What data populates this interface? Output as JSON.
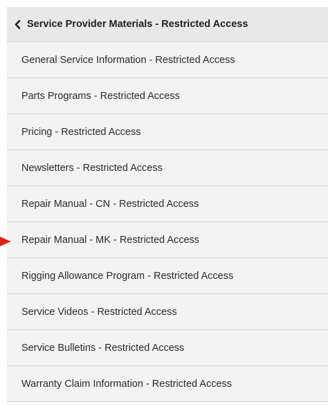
{
  "header": {
    "label": "Service Provider Materials - Restricted Access",
    "icon": "chevron-left-icon"
  },
  "items": [
    {
      "label": "General Service Information - Restricted Access"
    },
    {
      "label": "Parts Programs - Restricted Access"
    },
    {
      "label": "Pricing - Restricted Access"
    },
    {
      "label": "Newsletters - Restricted Access"
    },
    {
      "label": "Repair Manual - CN - Restricted Access"
    },
    {
      "label": "Repair Manual - MK - Restricted Access"
    },
    {
      "label": "Rigging Allowance Program - Restricted Access"
    },
    {
      "label": "Service Videos - Restricted Access"
    },
    {
      "label": "Service Bulletins - Restricted Access"
    },
    {
      "label": "Warranty Claim Information - Restricted Access"
    }
  ],
  "colors": {
    "pointer_arrow": "#e0211b",
    "header_bg": "#e8e8e8",
    "item_bg": "#f2f2f2"
  }
}
